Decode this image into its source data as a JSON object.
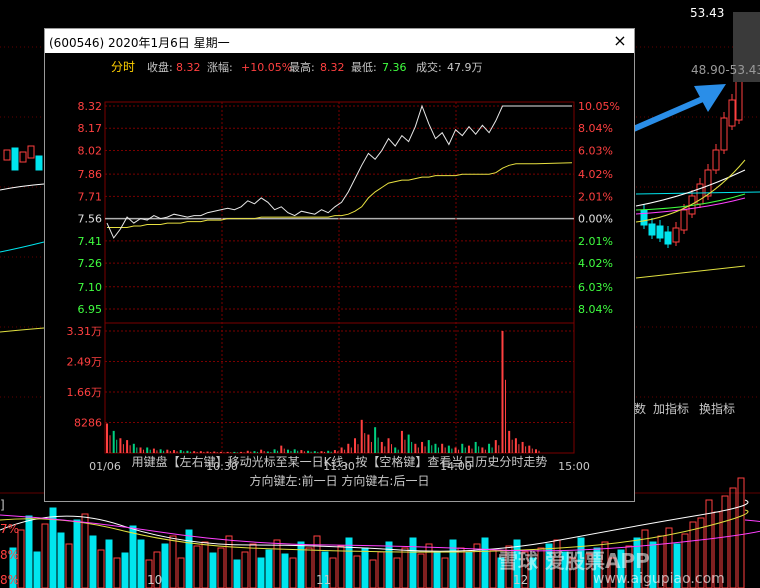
{
  "colors": {
    "up": "#ff4040",
    "down": "#00d080",
    "cyan": "#00e5ee",
    "line_white": "#e8e8e8",
    "avg_yellow": "#e8e040",
    "grid": "#7a0000",
    "axis_red": "#ff4040",
    "axis_green": "#40ff40",
    "label_gray": "#c8c8c8"
  },
  "background": {
    "price_top": "53.43",
    "price_range": "48.90-53.43",
    "toolbar": [
      "数",
      "加指标",
      "换指标"
    ],
    "left_pct": [
      "7%",
      "8%",
      "8%"
    ],
    "dates": [
      "10",
      "11",
      "12"
    ],
    "watermark": "雪球 爱股票APP",
    "watermark_url": "www.aigupiao.com",
    "box_label": "]"
  },
  "popup": {
    "title": "(600546) 2020年1月6日 星期一",
    "close": "×",
    "info_label_fenshi": "分时",
    "info_close_label": "收盘:",
    "info_close_value": "8.32",
    "info_change_label": "涨幅:",
    "info_change_value": "+10.05%",
    "info_high_label": "最高:",
    "info_high_value": "8.32",
    "info_low_label": "最低:",
    "info_low_value": "7.36",
    "info_volume_label": "成交:",
    "info_volume_value": "47.9万",
    "hint1": "用键盘【左右键】移动光标至某一日K线，按【空格键】查看当日历史分时走势",
    "hint2": "方向键左:前一日    方向键右:后一日"
  },
  "chart_data": {
    "type": "line",
    "title": "(600546) 2020年1月6日 星期一",
    "prev_close": 7.56,
    "price_ticks": [
      "8.32",
      "8.17",
      "8.02",
      "7.86",
      "7.71",
      "7.56",
      "7.41",
      "7.26",
      "7.10",
      "6.95"
    ],
    "pct_ticks": [
      "10.05%",
      "8.04%",
      "6.03%",
      "4.02%",
      "2.01%",
      "0.00%",
      "2.01%",
      "4.02%",
      "6.03%",
      "8.04%"
    ],
    "volume_ticks": [
      "3.31万",
      "2.49万",
      "1.66万",
      "8286"
    ],
    "time_ticks": [
      "01/06",
      "10:30",
      "11:30",
      "14:00",
      "15:00"
    ],
    "ylim": [
      6.95,
      8.32
    ],
    "volume_max": 33100,
    "series": [
      {
        "name": "price",
        "values": [
          7.53,
          7.43,
          7.49,
          7.57,
          7.53,
          7.56,
          7.55,
          7.58,
          7.56,
          7.57,
          7.59,
          7.58,
          7.57,
          7.58,
          7.58,
          7.6,
          7.61,
          7.62,
          7.63,
          7.62,
          7.64,
          7.68,
          7.66,
          7.7,
          7.67,
          7.62,
          7.64,
          7.6,
          7.58,
          7.61,
          7.6,
          7.59,
          7.62,
          7.6,
          7.64,
          7.67,
          7.74,
          7.83,
          7.92,
          8.0,
          7.96,
          8.02,
          8.1,
          8.05,
          8.12,
          8.08,
          8.18,
          8.32,
          8.2,
          8.1,
          8.14,
          8.06,
          8.16,
          8.12,
          8.18,
          8.13,
          8.19,
          8.14,
          8.22,
          8.32,
          8.32,
          8.32,
          8.32,
          8.32,
          8.32
        ]
      },
      {
        "name": "avg_price",
        "values": [
          7.5,
          7.5,
          7.5,
          7.5,
          7.51,
          7.51,
          7.52,
          7.52,
          7.52,
          7.53,
          7.53,
          7.53,
          7.54,
          7.54,
          7.54,
          7.55,
          7.55,
          7.55,
          7.56,
          7.56,
          7.56,
          7.56,
          7.56,
          7.57,
          7.57,
          7.57,
          7.57,
          7.57,
          7.57,
          7.57,
          7.57,
          7.57,
          7.57,
          7.57,
          7.58,
          7.58,
          7.59,
          7.61,
          7.64,
          7.7,
          7.74,
          7.77,
          7.8,
          7.81,
          7.82,
          7.82,
          7.83,
          7.84,
          7.84,
          7.85,
          7.85,
          7.85,
          7.85,
          7.86,
          7.86,
          7.86,
          7.86,
          7.86,
          7.87,
          7.9,
          7.92,
          7.93,
          7.93,
          7.93,
          7.93
        ]
      },
      {
        "name": "volume",
        "values": [
          8000,
          6000,
          4000,
          3500,
          2500,
          1500,
          1500,
          1200,
          1000,
          900,
          800,
          800,
          600,
          500,
          500,
          400,
          400,
          300,
          300,
          300,
          300,
          600,
          500,
          900,
          400,
          1000,
          2000,
          900,
          1000,
          800,
          600,
          500,
          500,
          600,
          800,
          1500,
          2500,
          4000,
          9000,
          5000,
          7000,
          3000,
          4000,
          1500,
          6000,
          5000,
          2500,
          3000,
          3500,
          2500,
          2500,
          2000,
          1500,
          2500,
          2000,
          3000,
          1500,
          2500,
          3500,
          33100,
          6000,
          4000,
          3000,
          2000,
          1000
        ]
      }
    ]
  }
}
